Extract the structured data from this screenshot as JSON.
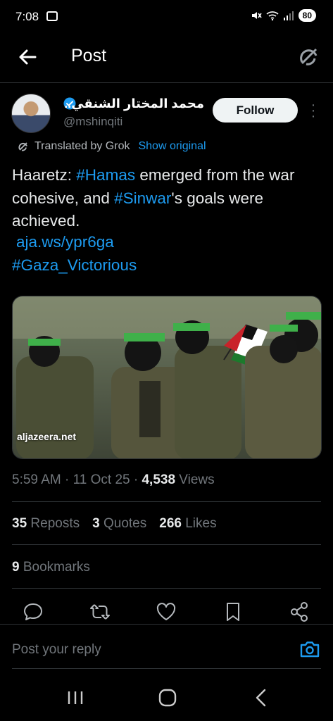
{
  "status_bar": {
    "time": "7:08",
    "battery": "80"
  },
  "header": {
    "title": "Post"
  },
  "author": {
    "name": "محمد المختار الشنقي...",
    "handle": "@mshinqiti",
    "follow_label": "Follow"
  },
  "translation": {
    "label": "Translated by Grok",
    "show_original": "Show original"
  },
  "tweet": {
    "text_part1": "Haaretz: ",
    "hashtag_hamas": "#Hamas",
    "text_part2": " emerged from the war cohesive, and ",
    "hashtag_sinwar": "#Sinwar",
    "text_part3": "'s goals were achieved.",
    "link": "aja.ws/ypr6ga",
    "hashtag_gaza": "#Gaza_Victorious"
  },
  "media": {
    "source_label": "aljazeera.net"
  },
  "meta": {
    "time": "5:59 AM",
    "sep1": " · ",
    "date": "11 Oct 25",
    "sep2": " · ",
    "views_count": "4,538",
    "views_label": " Views"
  },
  "stats": {
    "reposts_count": "35",
    "reposts_label": " Reposts",
    "quotes_count": "3",
    "quotes_label": " Quotes",
    "likes_count": "266",
    "likes_label": " Likes",
    "bookmarks_count": "9",
    "bookmarks_label": " Bookmarks"
  },
  "reply": {
    "placeholder": "Post your reply"
  },
  "colors": {
    "accent": "#1d9bf0",
    "background": "#000000",
    "text": "#e7e9ea",
    "muted": "#71767b"
  }
}
